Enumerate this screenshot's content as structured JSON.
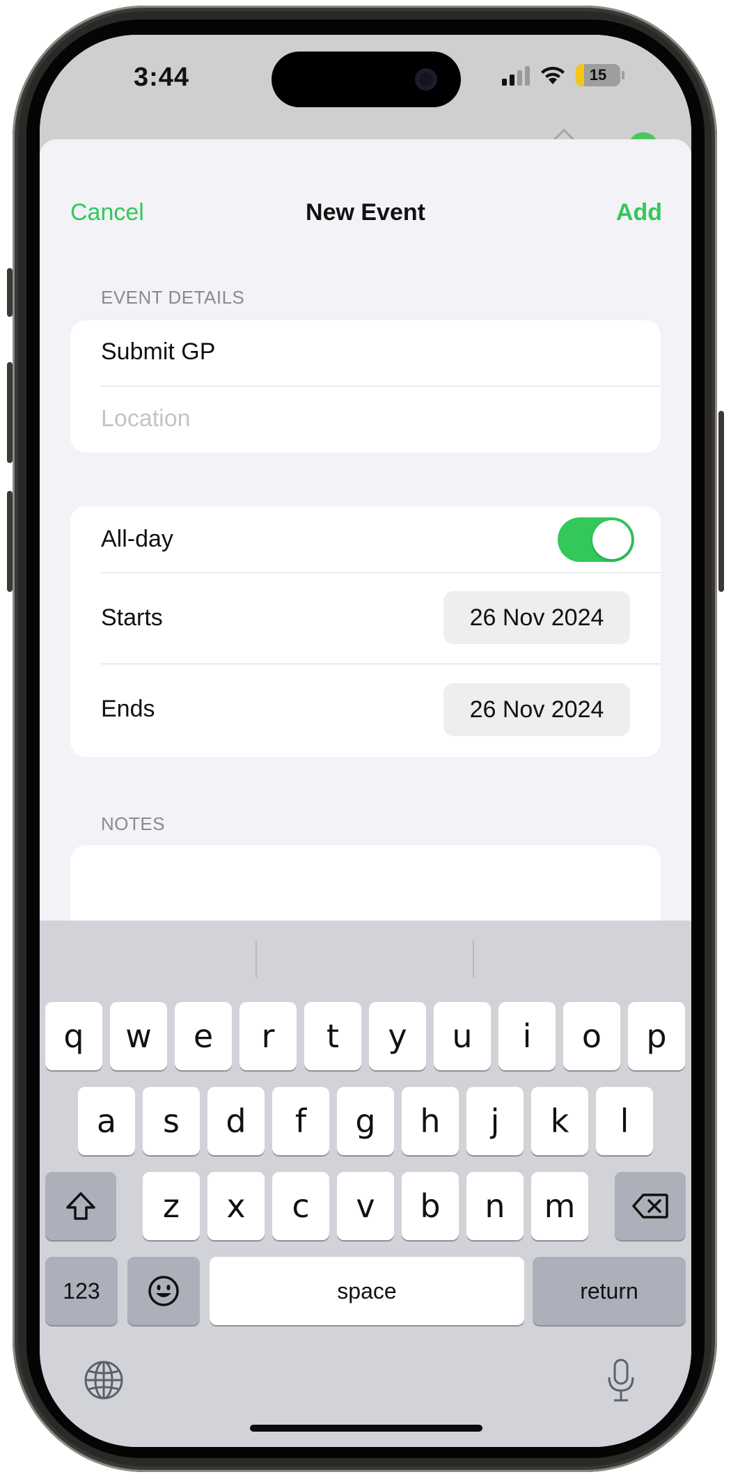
{
  "status_bar": {
    "time": "3:44",
    "battery": "15"
  },
  "nav": {
    "cancel": "Cancel",
    "title": "New Event",
    "add": "Add"
  },
  "event_details": {
    "header": "EVENT DETAILS",
    "title_value": "Submit GP",
    "location_placeholder": "Location"
  },
  "schedule": {
    "all_day_label": "All-day",
    "all_day_on": true,
    "starts_label": "Starts",
    "starts_value": "26 Nov 2024",
    "ends_label": "Ends",
    "ends_value": "26 Nov 2024"
  },
  "notes": {
    "header": "NOTES"
  },
  "keyboard": {
    "row1": [
      "q",
      "w",
      "e",
      "r",
      "t",
      "y",
      "u",
      "i",
      "o",
      "p"
    ],
    "row2": [
      "a",
      "s",
      "d",
      "f",
      "g",
      "h",
      "j",
      "k",
      "l"
    ],
    "row3": [
      "z",
      "x",
      "c",
      "v",
      "b",
      "n",
      "m"
    ],
    "numbers_label": "123",
    "space_label": "space",
    "return_label": "return"
  },
  "colors": {
    "accent": "#34c759",
    "sheet_bg": "#f2f2f7",
    "keyboard_bg": "#d1d3d9"
  }
}
